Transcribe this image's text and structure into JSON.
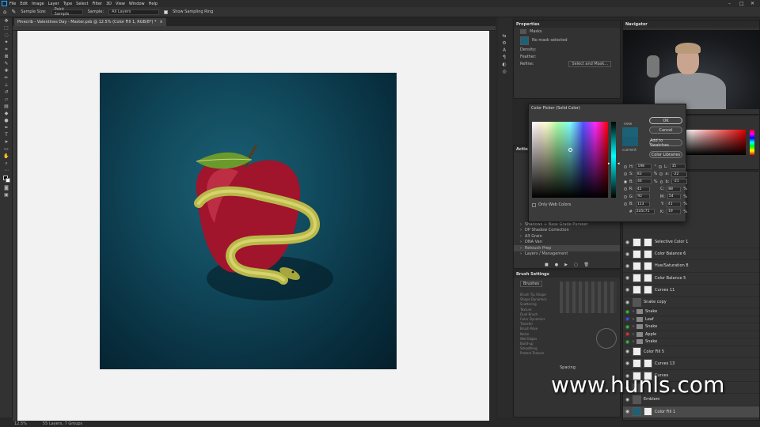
{
  "app": {
    "menu": [
      "File",
      "Edit",
      "Image",
      "Layer",
      "Type",
      "Select",
      "Filter",
      "3D",
      "View",
      "Window",
      "Help"
    ],
    "window_controls": [
      "–",
      "□",
      "✕"
    ]
  },
  "options_bar": {
    "sample_size_label": "Sample Size:",
    "sample_size_value": "Point Sample",
    "sample_label": "Sample:",
    "sample_value": "All Layers",
    "show_ring_label": "Show Sampling Ring"
  },
  "document": {
    "tab_title": "Pinecrib - Valentines Day - Master.psb @ 12.5% (Color Fill 1, RGB/8*) *",
    "tab_close": "×"
  },
  "status": {
    "zoom": "12.5%",
    "layers_info": "55 Layers, 7 Groups"
  },
  "properties": {
    "title": "Properties",
    "subtitle": "Masks",
    "mask_label": "No mask selected",
    "density_label": "Density:",
    "feather_label": "Feather:",
    "refine_label": "Refine:",
    "select_mask_btn": "Select and Mask..."
  },
  "navigator": {
    "title": "Navigator"
  },
  "color_picker": {
    "title": "Color Picker (Solid Color)",
    "ok": "OK",
    "cancel": "Cancel",
    "add_swatches": "Add to Swatches",
    "color_libraries": "Color Libraries",
    "new_label": "new",
    "current_label": "current",
    "only_web": "Only Web Colors",
    "new_color": "#1c6176",
    "current_color": "#1a5c71",
    "values": [
      {
        "l": "H:",
        "v": "198",
        "u": "°",
        "l2": "L:",
        "v2": "35"
      },
      {
        "l": "S:",
        "v": "83",
        "u": "%",
        "l2": "a:",
        "v2": "-22"
      },
      {
        "l": "B:",
        "v": "44",
        "u": "%",
        "l2": "b:",
        "v2": "-21"
      },
      {
        "l": "R:",
        "v": "42",
        "u": "",
        "l2": "C:",
        "v2": "88",
        "u2": "%"
      },
      {
        "l": "G:",
        "v": "92",
        "u": "",
        "l2": "M:",
        "v2": "54",
        "u2": "%"
      },
      {
        "l": "B:",
        "v": "113",
        "u": "",
        "l2": "Y:",
        "v2": "41",
        "u2": "%"
      },
      {
        "l": "#",
        "v": "2a5c71",
        "u": "",
        "l2": "K:",
        "v2": "19",
        "u2": "%"
      }
    ]
  },
  "actions": {
    "title": "Actions",
    "items": [
      "Shadows + Base Grade Purveer",
      "DP Shadow Correction",
      "A3 Grain",
      "DNA Van",
      "Retouch Prep",
      "Layers / Management"
    ]
  },
  "brush_settings": {
    "title": "Brush Settings",
    "brushes_btn": "Brushes",
    "options": [
      "Brush Tip Shape",
      "Shape Dynamics",
      "Scattering",
      "Texture",
      "Dual Brush",
      "Color Dynamics",
      "Transfer",
      "Brush Pose",
      "Noise",
      "Wet Edges",
      "Build-up",
      "Smoothing",
      "Protect Texture"
    ],
    "spacing_label": "Spacing"
  },
  "layers": {
    "rows": [
      {
        "name": "Selective Color 1",
        "thumb": "white"
      },
      {
        "name": "Color Balance 6",
        "thumb": "white"
      },
      {
        "name": "Hue/Saturation 8",
        "thumb": "white"
      },
      {
        "name": "Color Balance 5",
        "thumb": "white"
      },
      {
        "name": "Curves 11",
        "thumb": "white"
      },
      {
        "name": "Snake copy",
        "thumb": "dark"
      },
      {
        "name": "Snake",
        "thumb": "folder"
      },
      {
        "name": "Leaf",
        "thumb": "folder"
      },
      {
        "name": "Snake",
        "thumb": "folder"
      },
      {
        "name": "Apple",
        "thumb": "folder"
      },
      {
        "name": "Snake",
        "thumb": "folder"
      },
      {
        "name": "Color Fill 5",
        "thumb": "white"
      },
      {
        "name": "Curves 13",
        "thumb": "white"
      },
      {
        "name": "Curves",
        "thumb": "white"
      },
      {
        "name": "",
        "thumb": "dark"
      },
      {
        "name": "Emblem",
        "thumb": "dark"
      },
      {
        "name": "Color Fill 1",
        "thumb": "teal"
      }
    ]
  },
  "watermark": "www.hunls.com"
}
